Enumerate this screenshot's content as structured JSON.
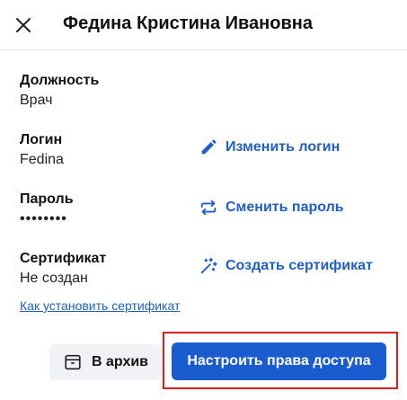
{
  "header": {
    "title": "Федина Кристина Ивановна"
  },
  "fields": {
    "position": {
      "label": "Должность",
      "value": "Врач"
    },
    "login": {
      "label": "Логин",
      "value": "Fedina"
    },
    "password": {
      "label": "Пароль",
      "value": "••••••••"
    },
    "certificate": {
      "label": "Сертификат",
      "value": "Не создан"
    }
  },
  "actions": {
    "change_login": "Изменить логин",
    "change_password": "Сменить пароль",
    "create_certificate": "Создать сертификат"
  },
  "install_link": "Как установить сертификат",
  "footer": {
    "archive_label": "В архив",
    "access_label": "Настроить права доступа"
  },
  "colors": {
    "accent": "#1a5cd0",
    "link": "#1f5fc7",
    "highlight": "#e11d1d"
  },
  "icons": {
    "close": "close-icon",
    "edit": "pencil-icon",
    "swap": "swap-arrows-icon",
    "wand": "magic-wand-icon",
    "archive": "archive-box-icon"
  }
}
